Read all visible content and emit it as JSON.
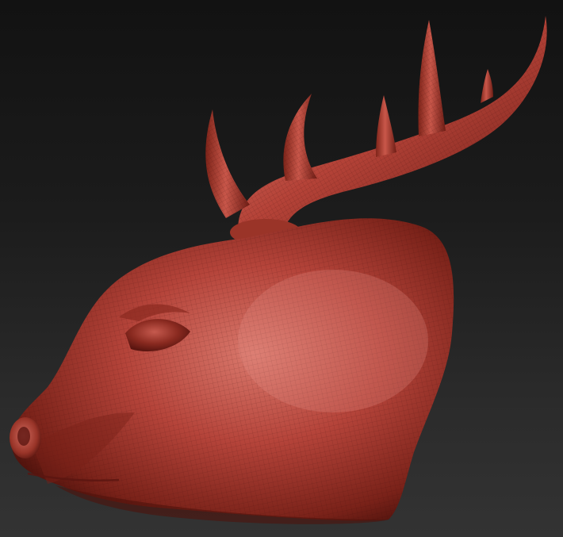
{
  "viewport": {
    "background_top": "#121212",
    "background_bottom": "#333333"
  },
  "model": {
    "subject": "deer-head-sculpt",
    "material_color": "#b5443a",
    "shadow_color": "#5a1510",
    "highlight_color": "#e27a6e",
    "wireframe_visible": true,
    "antler_tine_count": 5
  }
}
